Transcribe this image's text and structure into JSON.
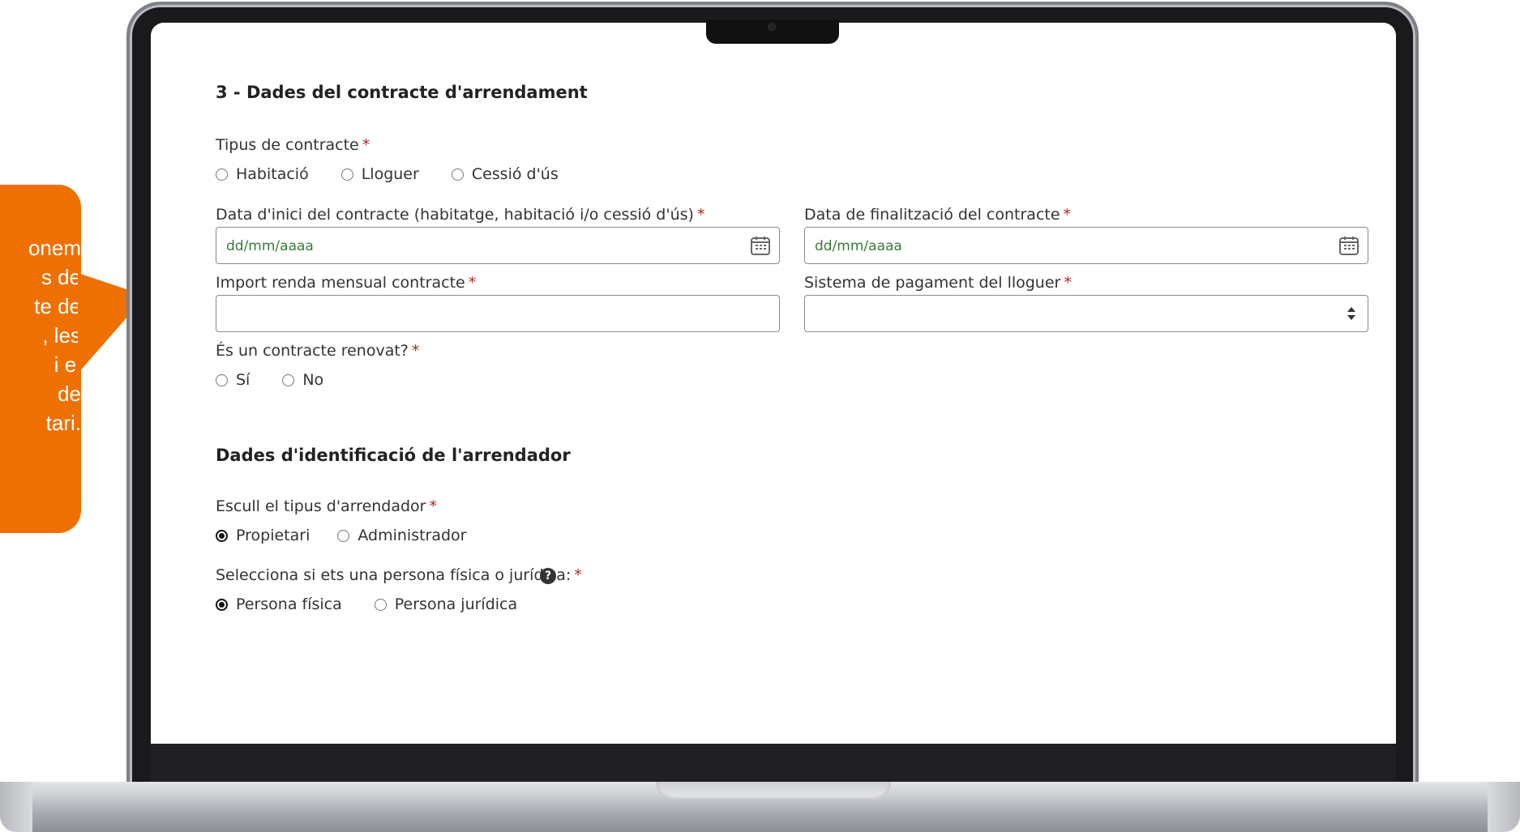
{
  "callout": {
    "lines": [
      "onem",
      "s de",
      "te de",
      ", les",
      "i el",
      "de",
      "tari."
    ]
  },
  "form": {
    "section_title": "3 - Dades del contracte d'arrendament",
    "required_marker": "*",
    "contract_type": {
      "label": "Tipus de contracte",
      "options": [
        "Habitació",
        "Lloguer",
        "Cessió d'ús"
      ]
    },
    "start_date": {
      "label": "Data d'inici del contracte (habitatge, habitació i/o cessió d'ús)",
      "placeholder": "dd/mm/aaaa"
    },
    "end_date": {
      "label": "Data de finalització del contracte",
      "placeholder": "dd/mm/aaaa"
    },
    "monthly_rent": {
      "label": "Import renda mensual contracte",
      "value": ""
    },
    "payment_system": {
      "label": "Sistema de pagament del lloguer",
      "value": ""
    },
    "renewed": {
      "label": "És un contracte renovat?",
      "options": [
        "Sí",
        "No"
      ]
    },
    "landlord_section_title": "Dades d'identificació de l'arrendador",
    "landlord_type": {
      "label": "Escull el tipus d'arrendador",
      "options": [
        "Propietari",
        "Administrador"
      ],
      "selected": "Propietari"
    },
    "person_type": {
      "label": "Selecciona si ets una persona física o jurídica:",
      "help": "?",
      "options": [
        "Persona física",
        "Persona jurídica"
      ],
      "selected": "Persona física"
    }
  },
  "colors": {
    "callout": "#ee7003",
    "required": "#b3261e",
    "placeholder": "#3c7a3c"
  }
}
